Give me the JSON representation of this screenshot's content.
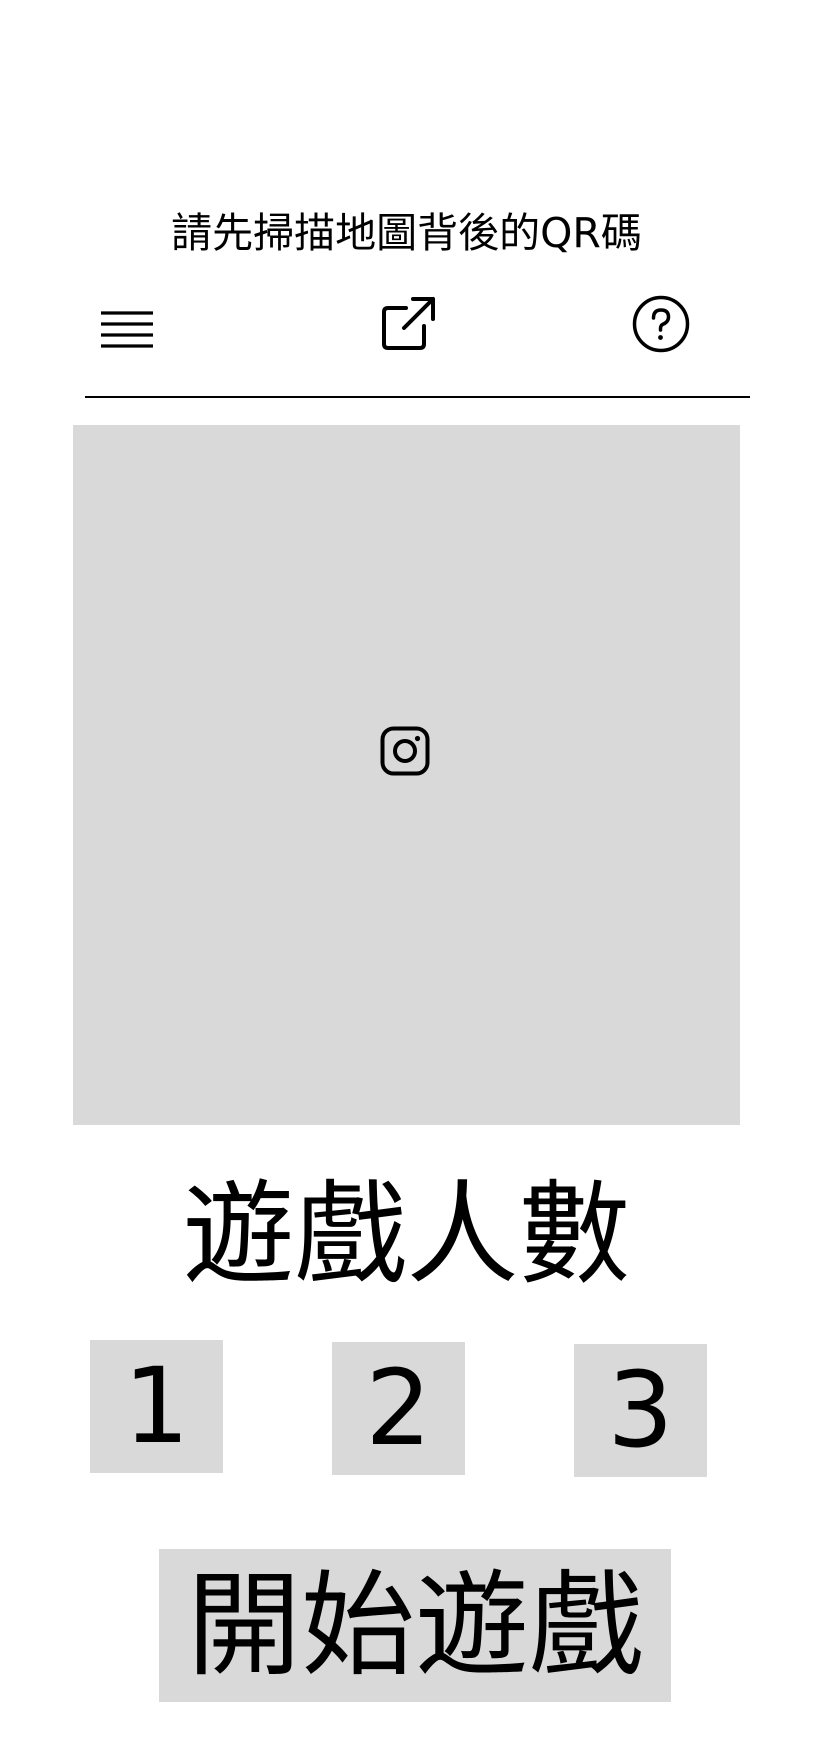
{
  "header": {
    "title": "請先掃描地圖背後的QR碼"
  },
  "toolbar": {
    "menu_icon": "menu-icon",
    "share_icon": "external-link-icon",
    "help_icon": "help-circle-icon"
  },
  "scanner": {
    "icon": "camera-icon",
    "background": "#d9d9d9"
  },
  "players": {
    "heading": "遊戲人數",
    "options": [
      "1",
      "2",
      "3"
    ]
  },
  "start_button": {
    "label": "開始遊戲"
  },
  "colors": {
    "button_background": "#d9d9d9",
    "text": "#000000",
    "page_background": "#ffffff"
  }
}
